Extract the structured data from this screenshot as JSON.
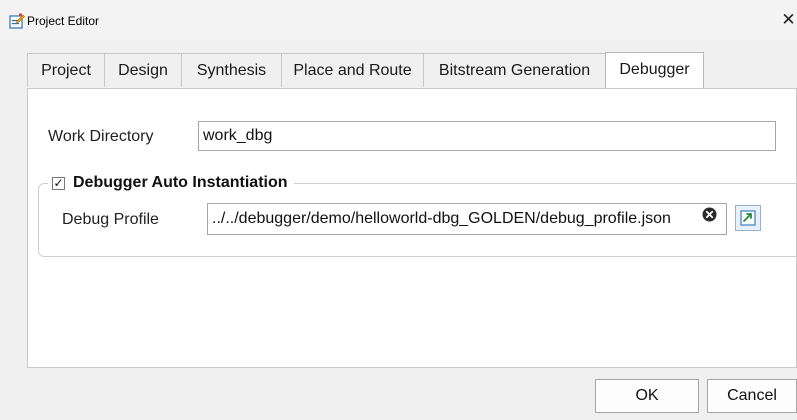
{
  "window": {
    "title": "Project Editor",
    "close_glyph": "✕"
  },
  "tabs": [
    {
      "label": "Project"
    },
    {
      "label": "Design"
    },
    {
      "label": "Synthesis"
    },
    {
      "label": "Place and Route"
    },
    {
      "label": "Bitstream Generation"
    },
    {
      "label": "Debugger"
    }
  ],
  "active_tab": "Debugger",
  "debugger": {
    "work_directory_label": "Work Directory",
    "work_directory_value": "work_dbg",
    "auto_instantiation": {
      "checkbox_glyph": "✓",
      "checked": true,
      "label": "Debugger Auto Instantiation"
    },
    "debug_profile_label": "Debug Profile",
    "debug_profile_value": "../../debugger/demo/helloworld-dbg_GOLDEN/debug_profile.json"
  },
  "buttons": {
    "ok": "OK",
    "cancel": "Cancel"
  },
  "icons": {
    "app": "project-editor-app-icon",
    "clear": "clear-circle-x-icon",
    "browse": "browse-folder-icon"
  },
  "colors": {
    "window_bg": "#f0f0f0",
    "panel_bg": "#ffffff",
    "browse_accent": "#2a8a3a"
  }
}
